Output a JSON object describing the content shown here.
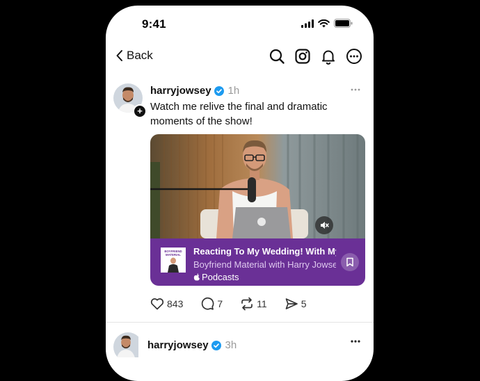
{
  "status_bar": {
    "time": "9:41"
  },
  "nav": {
    "back_label": "Back"
  },
  "post": {
    "username": "harryjowsey",
    "time": "1h",
    "text": "Watch me relive the final and dramatic moments of the show!",
    "podcast": {
      "title": "Reacting To My Wedding! With My",
      "subtitle": "Boyfriend Material with Harry Jowsey",
      "source": "Podcasts",
      "cover_text": "BOYFRIEND MATERIAL"
    },
    "stats": {
      "likes": "843",
      "replies": "7",
      "reposts": "11",
      "shares": "5"
    }
  },
  "post2": {
    "username": "harryjowsey",
    "time": "3h"
  },
  "colors": {
    "podcast_bar": "#6a3096",
    "verified": "#1d9bf0"
  },
  "icons": [
    "search-icon",
    "instagram-icon",
    "bell-icon",
    "more-icon",
    "heart-icon",
    "reply-icon",
    "repost-icon",
    "send-icon",
    "mute-icon",
    "bookmark-icon"
  ]
}
